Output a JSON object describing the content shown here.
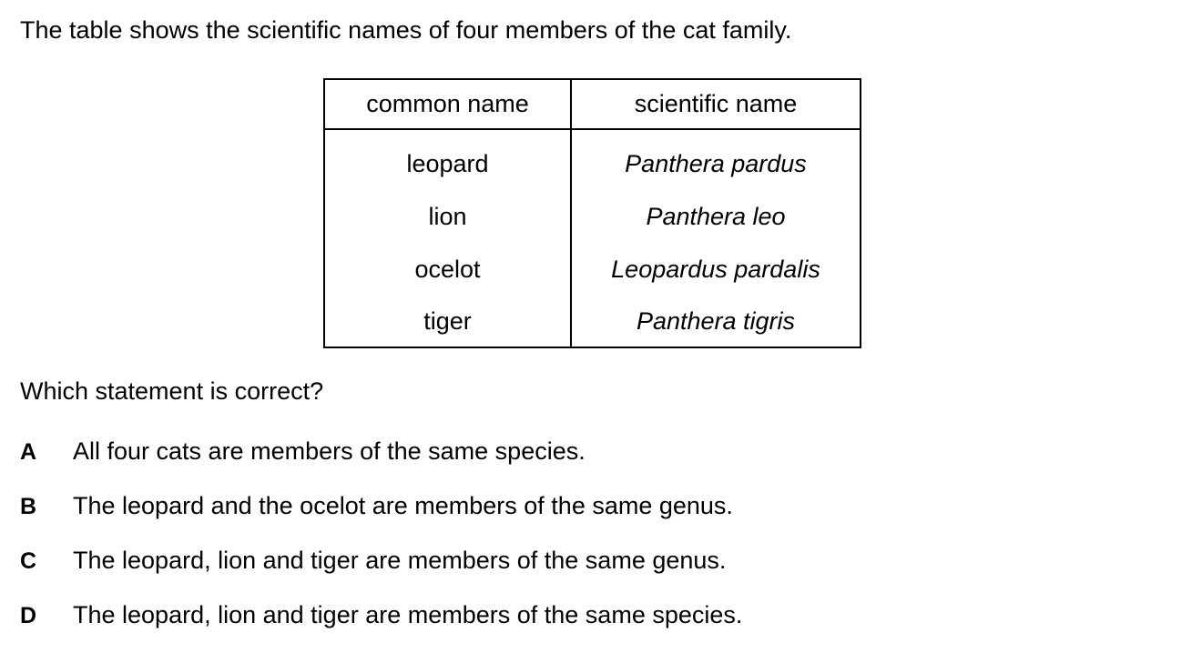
{
  "intro": "The table shows the scientific names of four members of the cat family.",
  "table": {
    "headers": [
      "common name",
      "scientific name"
    ],
    "rows": [
      {
        "common": "leopard",
        "scientific": "Panthera pardus"
      },
      {
        "common": "lion",
        "scientific": "Panthera leo"
      },
      {
        "common": "ocelot",
        "scientific": "Leopardus pardalis"
      },
      {
        "common": "tiger",
        "scientific": "Panthera tigris"
      }
    ]
  },
  "question": "Which statement is correct?",
  "options": [
    {
      "letter": "A",
      "text": "All four cats are members of the same species."
    },
    {
      "letter": "B",
      "text": "The leopard and the ocelot are members of the same genus."
    },
    {
      "letter": "C",
      "text": "The leopard, lion and tiger are members of the same genus."
    },
    {
      "letter": "D",
      "text": "The leopard, lion and tiger are members of the same species."
    }
  ]
}
